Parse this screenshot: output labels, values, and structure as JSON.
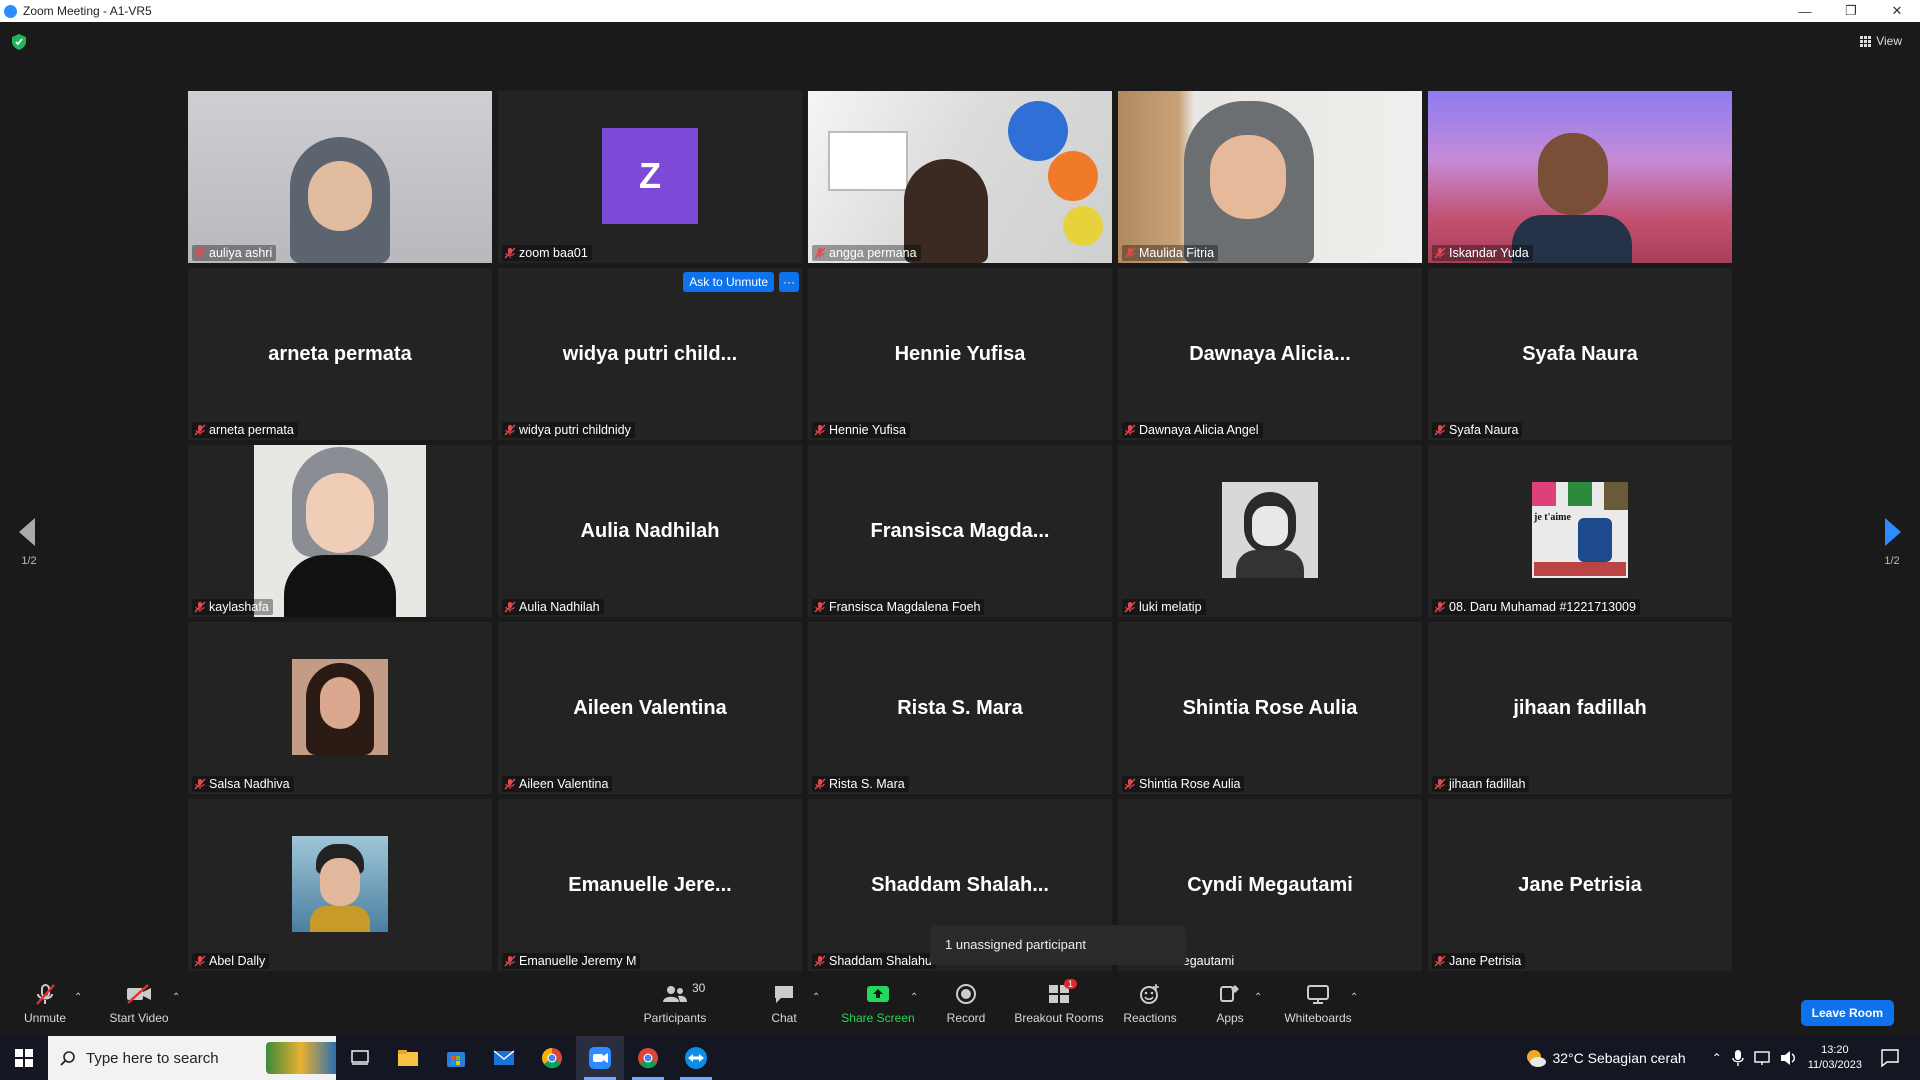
{
  "window": {
    "title": "Zoom Meeting - A1-VR5"
  },
  "top": {
    "view_label": "View"
  },
  "pager": {
    "left": "1/2",
    "right": "1/2"
  },
  "tiles": [
    {
      "name": "auliya ashri"
    },
    {
      "name": "zoom baa01",
      "avatar_letter": "Z"
    },
    {
      "name": "angga permana"
    },
    {
      "name": "Maulida Fitria"
    },
    {
      "name": "Iskandar Yuda"
    },
    {
      "name": "arneta permata",
      "display": "arneta permata"
    },
    {
      "name": "widya putri childnidy",
      "display": "widya putri child...",
      "ask_unmute": "Ask to Unmute",
      "more": "···"
    },
    {
      "name": "Hennie Yufisa",
      "display": "Hennie Yufisa"
    },
    {
      "name": "Dawnaya Alicia Angel",
      "display": "Dawnaya  Alicia..."
    },
    {
      "name": "Syafa Naura",
      "display": "Syafa Naura"
    },
    {
      "name": "kaylashafa"
    },
    {
      "name": "Aulia Nadhilah",
      "display": "Aulia Nadhilah"
    },
    {
      "name": "Fransisca Magdalena Foeh",
      "display": "Fransisca  Magda..."
    },
    {
      "name": "luki melatip"
    },
    {
      "name": "08. Daru Muhamad #1221713009",
      "thumb_text": "je t'aime"
    },
    {
      "name": "Salsa Nadhiva"
    },
    {
      "name": "Aileen Valentina",
      "display": "Aileen Valentina"
    },
    {
      "name": "Rista S. Mara",
      "display": "Rista S. Mara"
    },
    {
      "name": "Shintia Rose Aulia",
      "display": "Shintia Rose Aulia"
    },
    {
      "name": "jihaan fadillah",
      "display": "jihaan fadillah"
    },
    {
      "name": "Abel Dally"
    },
    {
      "name": "Emanuelle Jeremy M",
      "display": "Emanuelle  Jere..."
    },
    {
      "name": "Shaddam Shalahu",
      "display": "Shaddam  Shalah..."
    },
    {
      "name": "legautami",
      "display": "Cyndi Megautami"
    },
    {
      "name": "Jane Petrisia",
      "display": "Jane Petrisia"
    }
  ],
  "popup": {
    "text": "1 unassigned participant"
  },
  "toolbar": {
    "unmute": "Unmute",
    "start_video": "Start Video",
    "participants": "Participants",
    "participants_count": "30",
    "chat": "Chat",
    "share_screen": "Share Screen",
    "record": "Record",
    "breakout_rooms": "Breakout Rooms",
    "breakout_badge": "1",
    "reactions": "Reactions",
    "apps": "Apps",
    "whiteboards": "Whiteboards",
    "leave": "Leave Room"
  },
  "taskbar": {
    "search_placeholder": "Type here to search",
    "weather": "32°C  Sebagian cerah",
    "time": "13:20",
    "date": "11/03/2023"
  },
  "colors": {
    "accent": "#0e72ed",
    "share_green": "#23d959",
    "speaking": "#e6e36b",
    "avatar_purple": "#7c4ad6"
  }
}
